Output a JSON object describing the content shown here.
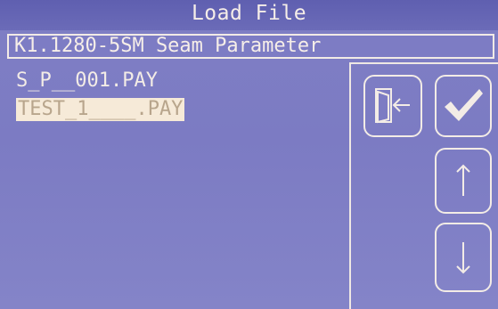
{
  "window": {
    "title": "Load File"
  },
  "path": {
    "value": "K1.1280-5SM Seam Parameter"
  },
  "files": [
    {
      "name": "S_P__001.PAY",
      "selected": false
    },
    {
      "name": "TEST_1____.PAY",
      "selected": true
    }
  ],
  "buttons": {
    "exit": "exit-icon",
    "confirm": "checkmark-icon",
    "up": "arrow-up-icon",
    "down": "arrow-down-icon"
  },
  "colors": {
    "background": "#7f7fc4",
    "foreground": "#f4ede6",
    "selection": "#f6ead8"
  }
}
